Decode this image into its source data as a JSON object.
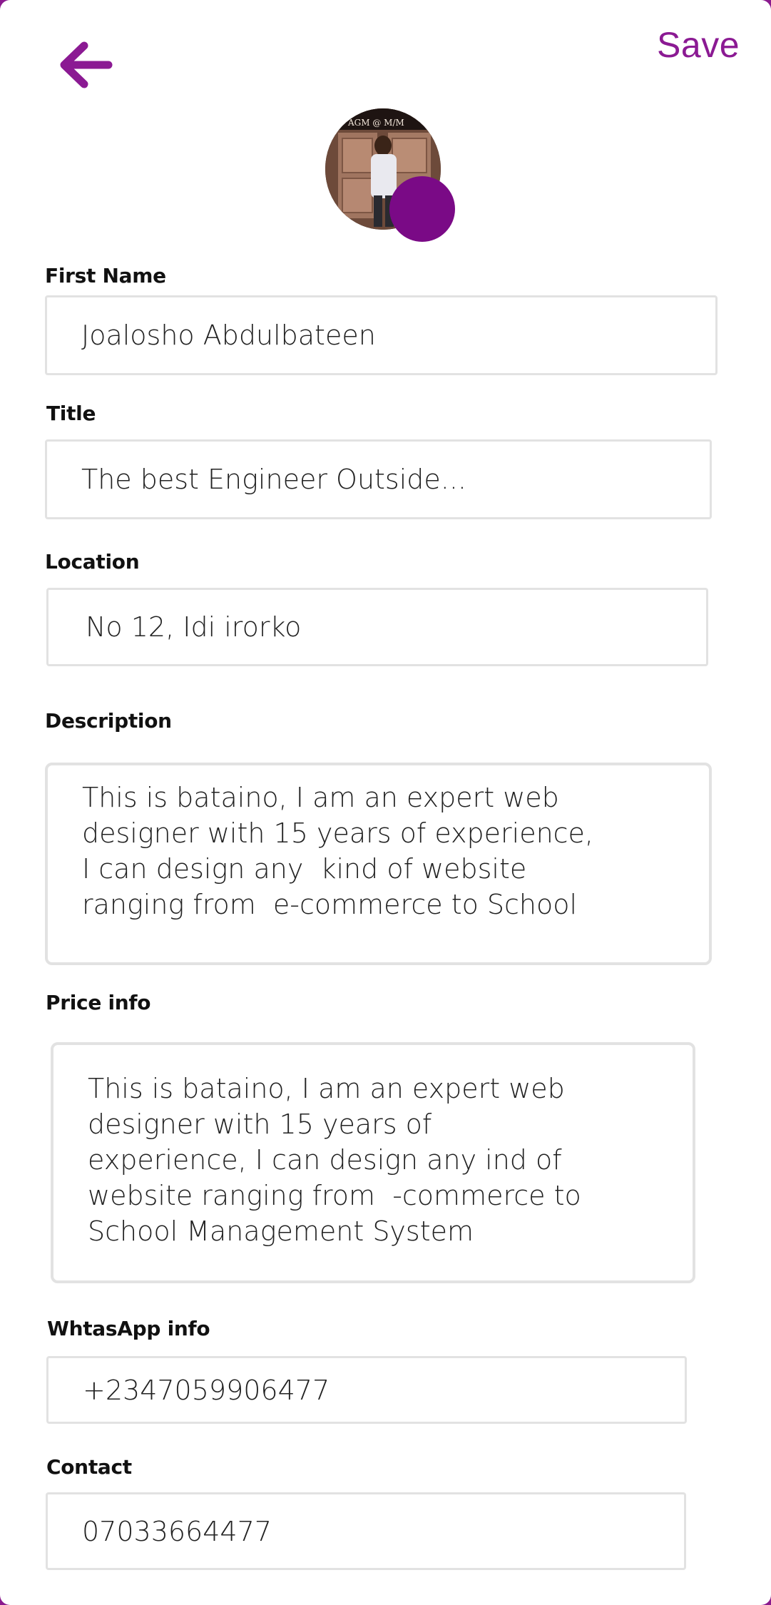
{
  "header": {
    "save_label": "Save",
    "back_icon": "arrow-left-icon"
  },
  "profile": {
    "avatar_overlay_text": "AGM @ M/M",
    "avatar_badge_icon": "camera-icon"
  },
  "form": {
    "first_name": {
      "label": "First Name",
      "value": "Joalosho Abdulbateen"
    },
    "title": {
      "label": "Title",
      "value": "The best Engineer Outside..."
    },
    "location": {
      "label": "Location",
      "value": "No 12, Idi irorko"
    },
    "description": {
      "label": "Description",
      "value": "This is bataino, I am an expert web designer with 15 years of experience, I can design any  kind of website ranging from  e-commerce to School"
    },
    "price_info": {
      "label": "Price info",
      "value": "This is bataino, I am an expert web designer with 15 years of  experience, I can design any ind of website ranging from  -commerce to School Management System"
    },
    "whatsapp": {
      "label": "WhtasApp info",
      "value": "+2347059906477"
    },
    "contact": {
      "label": "Contact",
      "value": "07033664477"
    }
  },
  "colors": {
    "accent": "#8b1a93",
    "frame": "#8a1a8e",
    "field_border": "#e2e2e2"
  }
}
